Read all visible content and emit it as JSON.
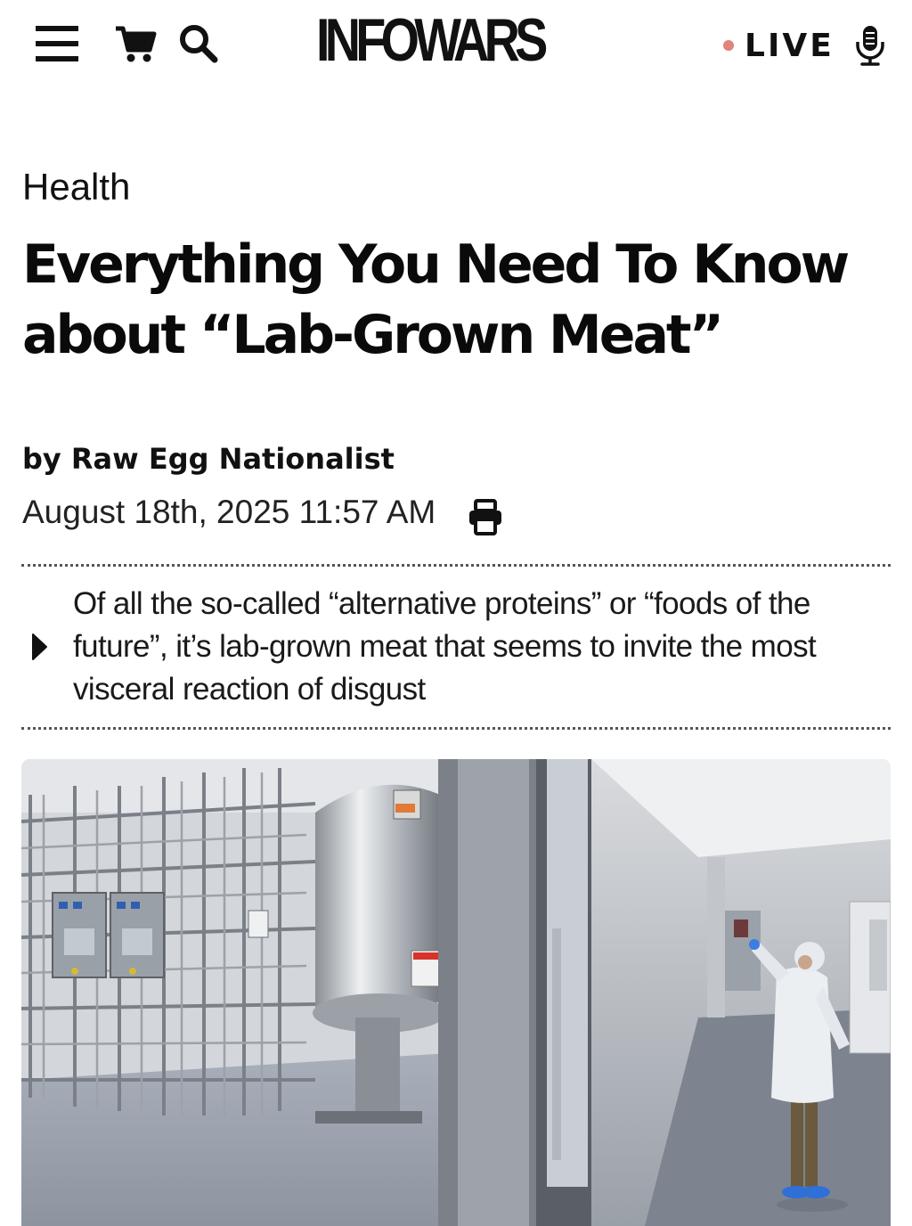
{
  "header": {
    "logo_text": "INFOWARS",
    "live_label": "LIVE",
    "icons": [
      "menu-icon",
      "cart-icon",
      "search-icon",
      "microphone-icon"
    ],
    "live_dot_color": "#e0837a"
  },
  "article": {
    "category": "Health",
    "title": "Everything You Need To Know about “Lab-Grown Meat”",
    "byline_prefix": "by",
    "author": "Raw Egg Nationalist",
    "date": "August 18th, 2025 11:57 AM",
    "summary": "Of all the so-called “alternative proteins” or “foods of the future”, it’s lab-grown meat that seems to invite the most visceral reaction of disgust",
    "print_icon": "print-icon",
    "hero_image": "lab-facility-photo"
  }
}
